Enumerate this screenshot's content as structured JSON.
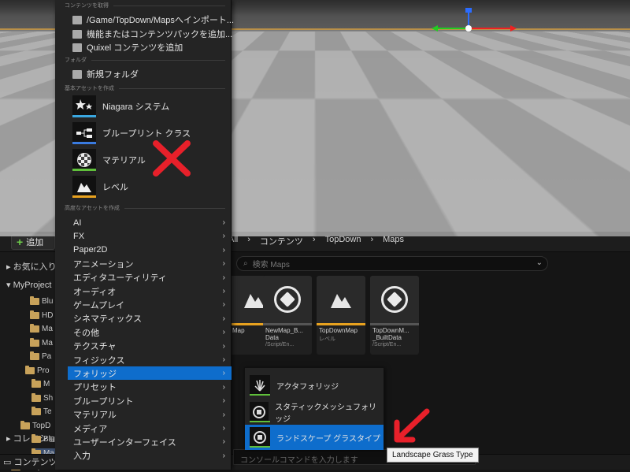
{
  "menu": {
    "sections": {
      "get_content": "コンテンツを取得",
      "folder": "フォルダ",
      "basic_assets": "基本アセットを作成",
      "advanced_assets": "高度なアセットを作成"
    },
    "get_content_items": [
      {
        "label": "/Game/TopDown/Mapsへインポート...",
        "icon": "import-icon"
      },
      {
        "label": "機能またはコンテンツパックを追加...",
        "icon": "content-pack-icon"
      },
      {
        "label": "Quixel コンテンツを追加",
        "icon": "quixel-icon"
      }
    ],
    "folder_item": {
      "label": "新規フォルダ",
      "icon": "new-folder-icon"
    },
    "basic_items": [
      {
        "label": "Niagara システム",
        "icon": "niagara-icon",
        "color": "#3aa7e0"
      },
      {
        "label": "ブループリント クラス",
        "icon": "blueprint-icon",
        "color": "#3a7be0"
      },
      {
        "label": "マテリアル",
        "icon": "material-icon",
        "color": "#5fbf3a"
      },
      {
        "label": "レベル",
        "icon": "level-icon",
        "color": "#e8a21f"
      }
    ],
    "advanced_items": [
      "AI",
      "FX",
      "Paper2D",
      "アニメーション",
      "エディタユーティリティ",
      "オーディオ",
      "ゲームプレイ",
      "シネマティックス",
      "その他",
      "テクスチャ",
      "フィジックス",
      "フォリッジ",
      "プリセット",
      "ブループリント",
      "マテリアル",
      "メディア",
      "ユーザーインターフェイス",
      "入力"
    ],
    "highlighted": "フォリッジ"
  },
  "submenu": {
    "items": [
      {
        "label": "アクタフォリッジ",
        "icon": "actor-foliage-icon"
      },
      {
        "label": "スタティックメッシュフォリッジ",
        "icon": "static-mesh-foliage-icon"
      },
      {
        "label": "ランドスケープ グラスタイプ",
        "icon": "landscape-grass-icon"
      }
    ],
    "highlighted": "ランドスケープ グラスタイプ"
  },
  "tooltip": "Landscape Grass Type",
  "content_browser": {
    "add_label": "追加",
    "favorites": "お気に入り",
    "project": "MyProject",
    "collections": "コレクション",
    "bottom_tab": "コンテンツ",
    "tree": [
      "Blu",
      "HD",
      "Ma",
      "Ma",
      "Pa",
      "Pro",
      "M",
      "Sh",
      "Te",
      "TopD",
      "Blu",
      "Ma",
      "Temp"
    ],
    "breadcrumb": [
      "All",
      "コンテンツ",
      "TopDown",
      "Maps"
    ],
    "search_placeholder": "検索 Maps",
    "console_placeholder": "コンソールコマンドを入力します",
    "assets": [
      {
        "name": "Map",
        "type": ""
      },
      {
        "name": "NewMap_B...\nData",
        "type": "/Script/En..."
      },
      {
        "name": "TopDownMap",
        "type": "レベル"
      },
      {
        "name": "TopDownM...\n_BuiltData",
        "type": "/Script/En..."
      }
    ]
  },
  "annotation": {
    "cross_color": "#e8202a",
    "arrow_color": "#e8202a"
  }
}
